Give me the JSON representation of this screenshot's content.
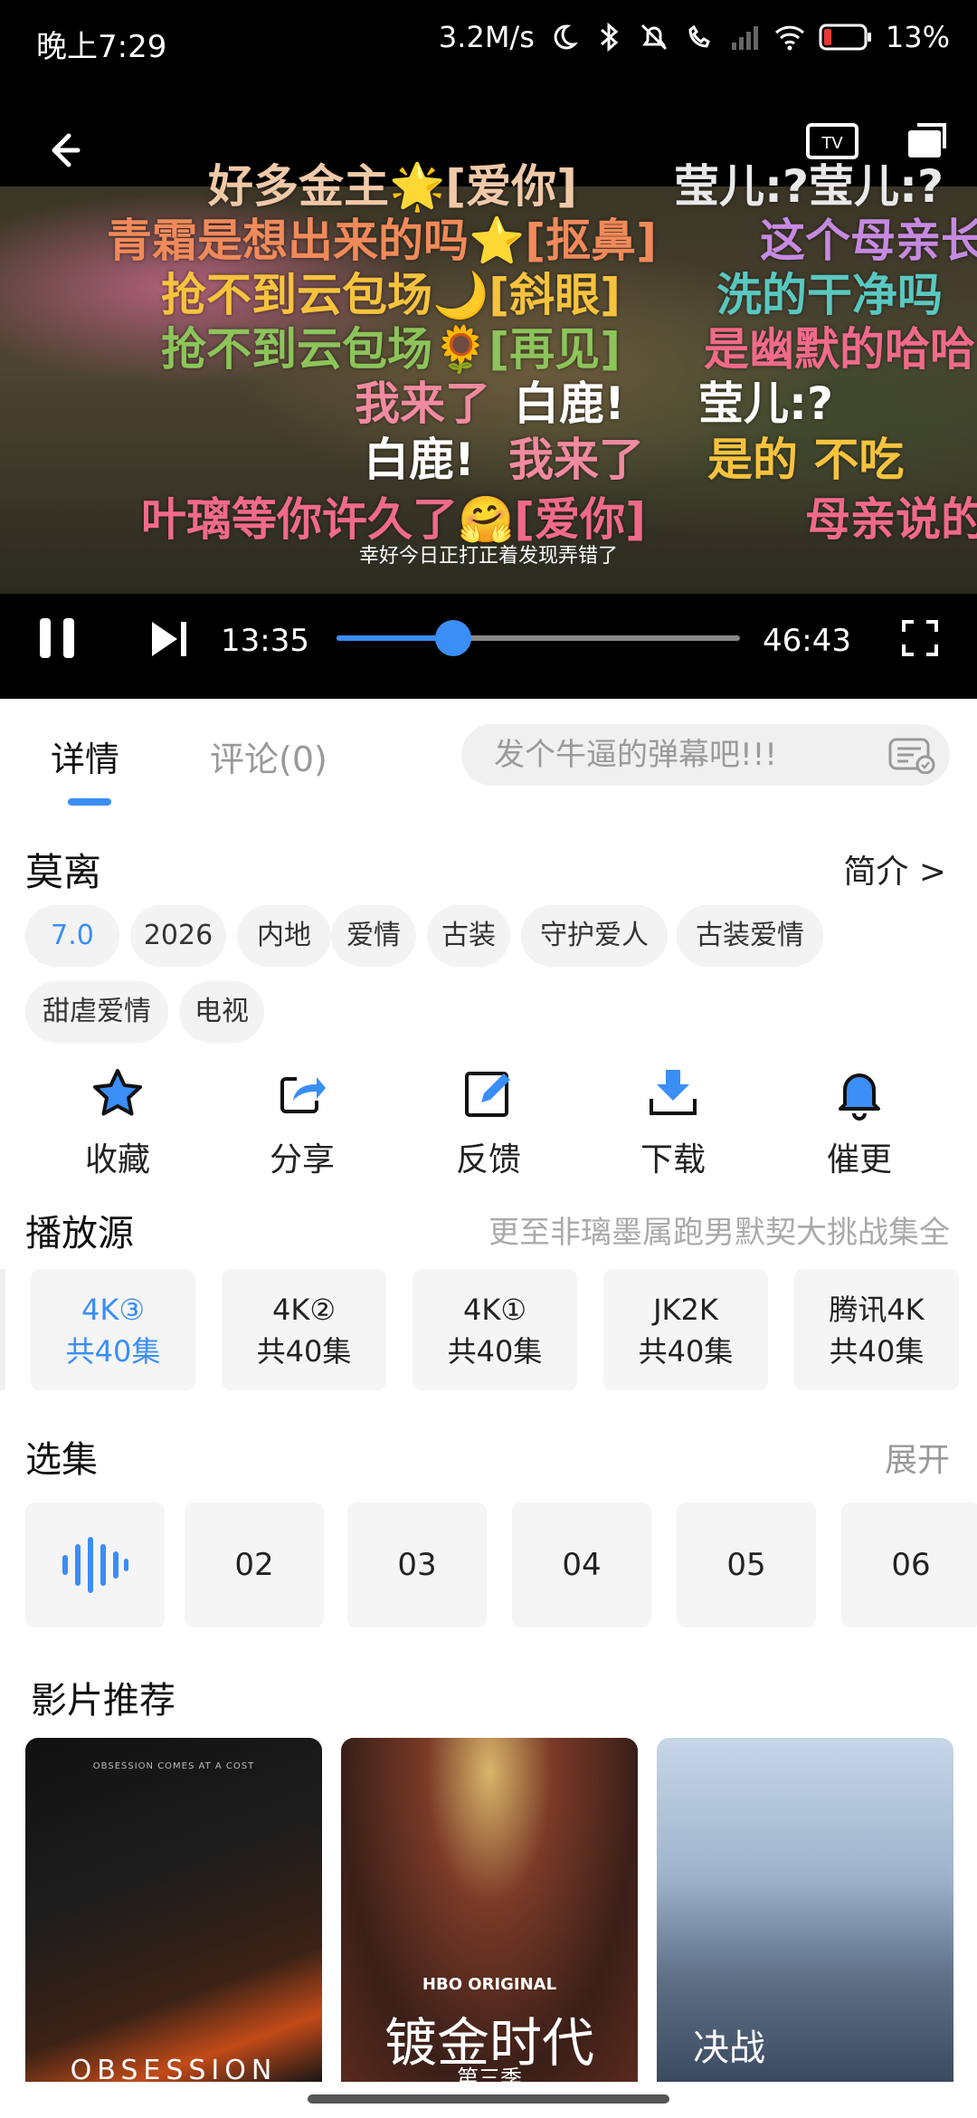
{
  "status_bar": {
    "time": "晚上7:29",
    "speed": "3.2M/s",
    "battery": "13%"
  },
  "player": {
    "subtitle": "幸好今日正打正着发现弄错了",
    "time_current": "13:35",
    "time_total": "46:43",
    "progress": 0.29,
    "danmaku": [
      {
        "text": "好多金主🌟[爱你]",
        "color": "#f0c9a8"
      },
      {
        "text": "莹儿:?莹儿:?",
        "color": "#e9e9e9"
      },
      {
        "text": "青霜是想出来的吗⭐[抠鼻]",
        "color": "#f08a5a"
      },
      {
        "text": "这个母亲长",
        "color": "#c58ae0"
      },
      {
        "text": "抢不到云包场🌙[斜眼]",
        "color": "#f7c33d"
      },
      {
        "text": "洗的干净吗",
        "color": "#59c8c0"
      },
      {
        "text": "抢不到云包场🌻[再见]",
        "color": "#8cc45a"
      },
      {
        "text": "是幽默的哈哈",
        "color": "#f06a8a"
      },
      {
        "text": "我来了",
        "color": "#f08aa0"
      },
      {
        "text": "白鹿!",
        "color": "#ffffff"
      },
      {
        "text": "莹儿:?",
        "color": "#ffffff"
      },
      {
        "text": "白鹿!",
        "color": "#ffffff"
      },
      {
        "text": "我来了",
        "color": "#f08aa0"
      },
      {
        "text": "是的 不吃",
        "color": "#f7c33d"
      },
      {
        "text": "叶璃等你许久了🤗[爱你]",
        "color": "#f06a8a"
      },
      {
        "text": "母亲说的",
        "color": "#f06a8a"
      }
    ]
  },
  "tabs": {
    "details": "详情",
    "comments": "评论(0)"
  },
  "danmu_input": {
    "placeholder": "发个牛逼的弹幕吧!!!"
  },
  "show": {
    "title": "莫离",
    "intro_link": "简介 >",
    "tags": [
      "7.0分",
      "2026",
      "内地",
      "爱情",
      "古装",
      "守护爱人",
      "古装爱情",
      "甜虐爱情",
      "电视"
    ]
  },
  "actions": [
    {
      "label": "收藏",
      "icon": "star-icon"
    },
    {
      "label": "分享",
      "icon": "share-icon"
    },
    {
      "label": "反馈",
      "icon": "edit-icon"
    },
    {
      "label": "下载",
      "icon": "download-icon"
    },
    {
      "label": "催更",
      "icon": "bell-icon"
    }
  ],
  "sources": {
    "title": "播放源",
    "hint": "更至非璃墨属跑男默契大挑战集全",
    "items": [
      {
        "name": "4K③",
        "count": "共40集"
      },
      {
        "name": "4K②",
        "count": "共40集"
      },
      {
        "name": "4K①",
        "count": "共40集"
      },
      {
        "name": "JK2K",
        "count": "共40集"
      },
      {
        "name": "腾讯4K",
        "count": "共40集"
      }
    ]
  },
  "episodes": {
    "title": "选集",
    "expand": "展开",
    "items": [
      "02",
      "03",
      "04",
      "05",
      "06"
    ]
  },
  "recommend": {
    "title": "影片推荐",
    "posters": [
      {
        "tagline": "OBSESSION          COMES AT A COST",
        "title": "OBSESSION"
      },
      {
        "brand": "HBO ORIGINAL",
        "title": "镀金时代",
        "sub": "第三季"
      },
      {
        "title": "决战"
      }
    ]
  },
  "colors": {
    "accent": "#3a8ef6"
  }
}
